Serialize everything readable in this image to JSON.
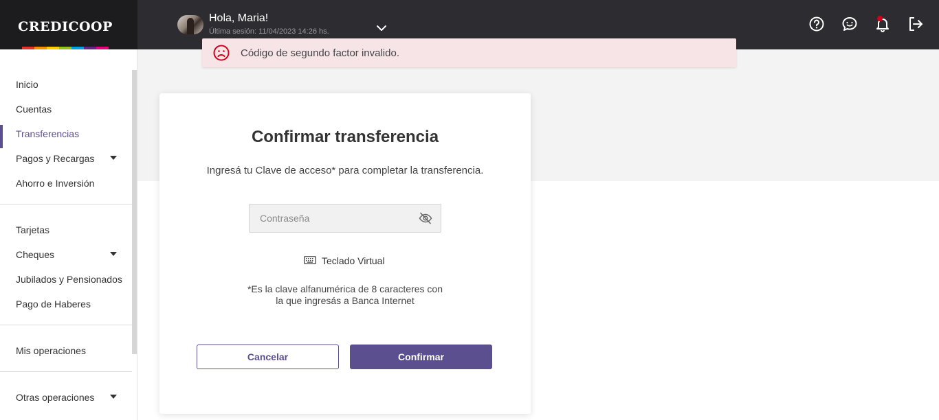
{
  "brand": {
    "name": "CREDICOOP",
    "stripe_colors": [
      "#e6332a",
      "#f39200",
      "#ffcc00",
      "#95c11f",
      "#009fe3",
      "#662483",
      "#e5007e"
    ]
  },
  "header": {
    "greeting": "Hola, Maria!",
    "last_session": "Última sesión: 11/04/2023 14:26 hs.",
    "icons": [
      "help-icon",
      "chat-icon",
      "bell-icon",
      "logout-icon"
    ]
  },
  "toast": {
    "message": "Código de segundo factor invalido.",
    "icon": "sad-face-icon",
    "color": "#d0021b"
  },
  "sidebar": {
    "accent": "#5b4f8f",
    "items": [
      {
        "label": "Inicio"
      },
      {
        "label": "Cuentas"
      },
      {
        "label": "Transferencias",
        "active": true
      },
      {
        "label": "Pagos y Recargas",
        "expandable": true
      },
      {
        "label": "Ahorro e Inversión"
      },
      {
        "label": "Tarjetas"
      },
      {
        "label": "Cheques",
        "expandable": true
      },
      {
        "label": "Jubilados y Pensionados"
      },
      {
        "label": "Pago de Haberes"
      },
      {
        "label": "Mis operaciones"
      },
      {
        "label": "Otras operaciones",
        "expandable": true
      }
    ]
  },
  "modal": {
    "title": "Confirmar transferencia",
    "subtitle": "Ingresá tu Clave de acceso* para completar la transferencia.",
    "password_placeholder": "Contraseña",
    "password_value": "",
    "virtual_keyboard": "Teclado Virtual",
    "note_line1": "*Es la clave alfanumérica de 8 caracteres con",
    "note_line2": "la que ingresás a Banca Internet",
    "cancel_label": "Cancelar",
    "confirm_label": "Confirmar"
  }
}
